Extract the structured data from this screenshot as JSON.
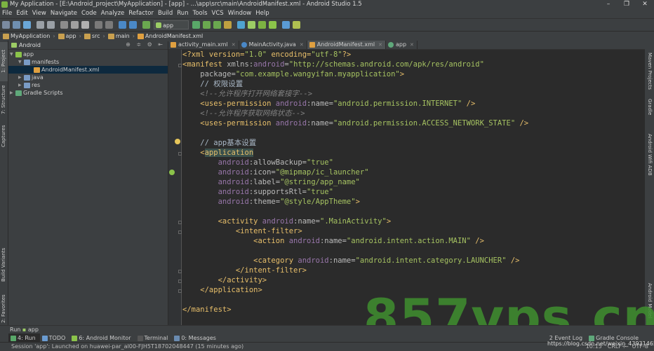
{
  "window": {
    "title": "My Application - [E:\\Android_project\\MyApplication] - [app] - ...\\app\\src\\main\\AndroidManifest.xml - Android Studio 1.5",
    "controls": [
      "–",
      "❐",
      "✕"
    ]
  },
  "menu": [
    "File",
    "Edit",
    "View",
    "Navigate",
    "Code",
    "Analyze",
    "Refactor",
    "Build",
    "Run",
    "Tools",
    "VCS",
    "Window",
    "Help"
  ],
  "toolbar": {
    "config_select": "app"
  },
  "breadcrumbs": [
    "MyApplication",
    "app",
    "src",
    "main",
    "AndroidManifest.xml"
  ],
  "left_tool_tabs": [
    "1: Project",
    "7: Structure",
    "Captures",
    "Build Variants",
    "2: Favorites"
  ],
  "right_tool_tabs": [
    "Maven Projects",
    "Gradle",
    "Android Wifi ADB",
    "Android Model"
  ],
  "project_panel": {
    "view_mode": "Android",
    "tree": [
      {
        "label": "app",
        "level": 0
      },
      {
        "label": "manifests",
        "level": 1
      },
      {
        "label": "AndroidManifest.xml",
        "level": 2,
        "selected": true
      },
      {
        "label": "java",
        "level": 1
      },
      {
        "label": "res",
        "level": 1
      },
      {
        "label": "Gradle Scripts",
        "level": 0
      }
    ]
  },
  "editor_tabs": [
    {
      "label": "activity_main.xml",
      "active": false
    },
    {
      "label": "MainActivity.java",
      "active": false
    },
    {
      "label": "AndroidManifest.xml",
      "active": true
    },
    {
      "label": "app",
      "active": false
    }
  ],
  "code": {
    "l1_a": "<?xml version=",
    "l1_b": "\"1.0\"",
    "l1_c": " encoding=",
    "l1_d": "\"utf-8\"",
    "l1_e": "?>",
    "l2_a": "<manifest ",
    "l2_b": "xmlns:",
    "l2_c": "android",
    "l2_d": "=",
    "l2_e": "\"http://schemas.android.com/apk/res/android\"",
    "l3_a": "    package=",
    "l3_b": "\"com.example.wangyifan.myapplication\"",
    "l3_c": ">",
    "l4": "    // 权限设置",
    "l5": "    <!--允许程序打开网络套接字-->",
    "l6_a": "    <uses-permission ",
    "l6_b": "android",
    "l6_c": ":name=",
    "l6_d": "\"android.permission.INTERNET\"",
    "l6_e": " />",
    "l7": "    <!--允许程序获取网络状态-->",
    "l8_a": "    <uses-permission ",
    "l8_b": "android",
    "l8_c": ":name=",
    "l8_d": "\"android.permission.ACCESS_NETWORK_STATE\"",
    "l8_e": " />",
    "l10": "    // app基本设置",
    "l11_a": "    <",
    "l11_b": "application",
    "l12_a": "        android",
    "l12_b": ":allowBackup=",
    "l12_c": "\"true\"",
    "l13_a": "        android",
    "l13_b": ":icon=",
    "l13_c": "\"@mipmap/ic_launcher\"",
    "l14_a": "        android",
    "l14_b": ":label=",
    "l14_c": "\"@string/app_name\"",
    "l15_a": "        android",
    "l15_b": ":supportsRtl=",
    "l15_c": "\"true\"",
    "l16_a": "        android",
    "l16_b": ":theme=",
    "l16_c": "\"@style/AppTheme\"",
    "l16_d": ">",
    "l18_a": "        <activity ",
    "l18_b": "android",
    "l18_c": ":name=",
    "l18_d": "\".MainActivity\"",
    "l18_e": ">",
    "l19": "            <intent-filter>",
    "l20_a": "                <action ",
    "l20_b": "android",
    "l20_c": ":name=",
    "l20_d": "\"android.intent.action.MAIN\"",
    "l20_e": " />",
    "l22_a": "                <category ",
    "l22_b": "android",
    "l22_c": ":name=",
    "l22_d": "\"android.intent.category.LAUNCHER\"",
    "l22_e": " />",
    "l23": "            </intent-filter>",
    "l24": "        </activity>",
    "l25": "    </application>",
    "l27": "</manifest>"
  },
  "bottom": {
    "run_label": "Run",
    "run_config": "app",
    "tabs": [
      "4: Run",
      "TODO",
      "6: Android Monitor",
      "Terminal",
      "0: Messages"
    ],
    "tabs_right": [
      "2 Event Log",
      "Gradle Console"
    ]
  },
  "status": {
    "message": "Session 'app': Launched on huawei-par_al00-FJH5T18702048447 (15 minutes ago)",
    "position": "10:15",
    "line_sep": "CRLF÷",
    "encoding": "UTF-8"
  },
  "watermark": {
    "text": "857vps.cn",
    "url": "https://blog.csdn.net/weixin_43931465"
  },
  "colors": {
    "accent_green": "#3f8f2f",
    "tag": "#e8bf6a",
    "string": "#a5c261",
    "namespace": "#9876aa"
  }
}
